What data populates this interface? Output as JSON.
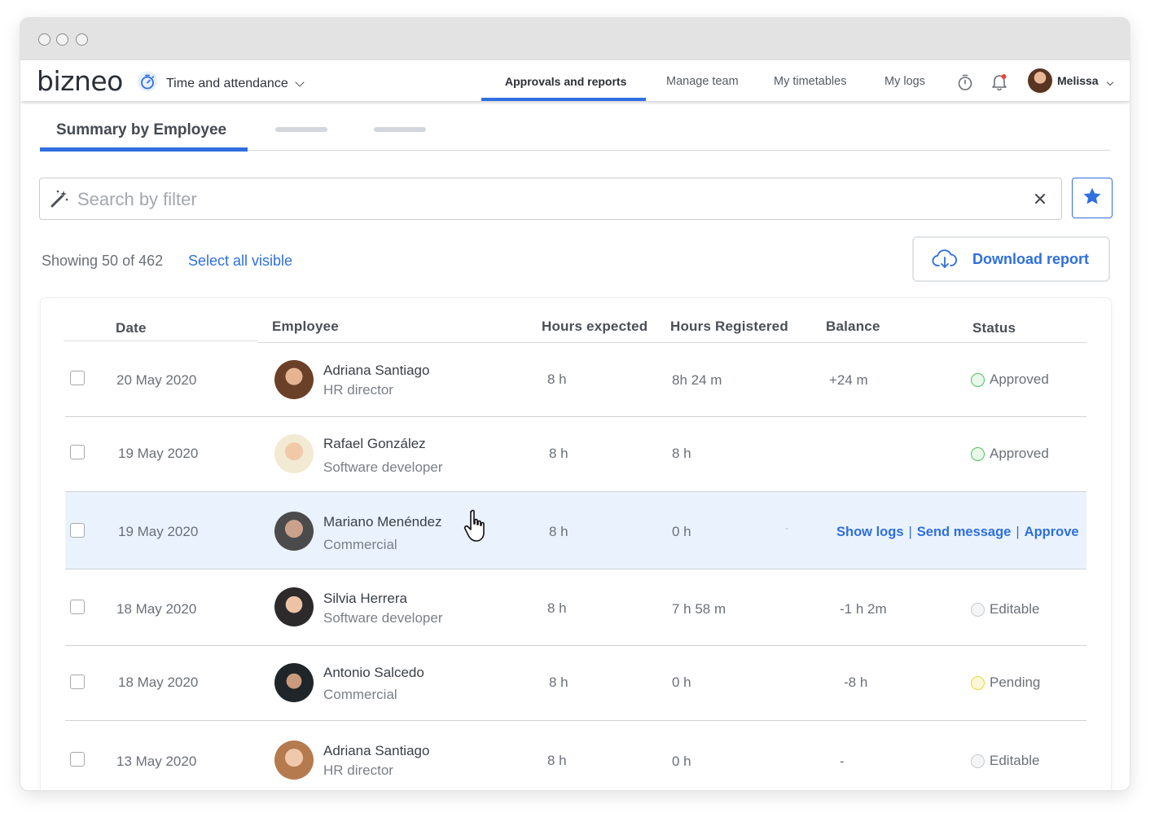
{
  "app": {
    "logo": "bizneo",
    "module": "Time and attendance",
    "user": "Melissa"
  },
  "nav": {
    "items": [
      "Approvals and reports",
      "Manage team",
      "My timetables",
      "My logs"
    ],
    "active": 0
  },
  "tabs": {
    "active_label": "Summary by Employee"
  },
  "search": {
    "placeholder": "Search by filter",
    "value": ""
  },
  "list": {
    "showing": "Showing 50 of 462",
    "select_all": "Select all visible",
    "download": "Download report"
  },
  "table": {
    "columns": [
      "Date",
      "Employee",
      "Hours expected",
      "Hours Registered",
      "Balance",
      "Status"
    ],
    "rows": [
      {
        "date": "20 May 2020",
        "name": "Adriana Santiago",
        "role": "HR director",
        "expected": "8 h",
        "registered": "8h 24 m",
        "balance": "+24 m",
        "status": "Approved"
      },
      {
        "date": "19 May 2020",
        "name": "Rafael González",
        "role": "Software developer",
        "expected": "8 h",
        "registered": "8 h",
        "balance": "",
        "status": "Approved"
      },
      {
        "date": "19 May 2020",
        "name": "Mariano Menéndez",
        "role": "Commercial",
        "expected": "8 h",
        "registered": "0 h",
        "balance": "-",
        "status": ""
      },
      {
        "date": "18 May 2020",
        "name": "Silvia Herrera",
        "role": "Software developer",
        "expected": "8 h",
        "registered": "7 h 58 m",
        "balance": "-1 h 2m",
        "status": "Editable"
      },
      {
        "date": "18 May 2020",
        "name": "Antonio Salcedo",
        "role": "Commercial",
        "expected": "8 h",
        "registered": "0 h",
        "balance": "-8 h",
        "status": "Pending"
      },
      {
        "date": "13 May 2020",
        "name": "Adriana Santiago",
        "role": "HR director",
        "expected": "8 h",
        "registered": "0 h",
        "balance": "-",
        "status": "Editable"
      }
    ],
    "hover_actions": [
      "Show logs",
      "Send message",
      "Approve"
    ],
    "hover_separator": "|"
  },
  "colors": {
    "accent": "#2f6fdf",
    "approved": "#4cc45b",
    "pending": "#e8d83a",
    "editable": "#c8cbd0",
    "hover_row": "#eaf3fd"
  },
  "icons": {
    "module": "stopwatch-icon",
    "search": "magic-wand-icon",
    "favorite": "star-icon",
    "download": "cloud-download-icon"
  }
}
